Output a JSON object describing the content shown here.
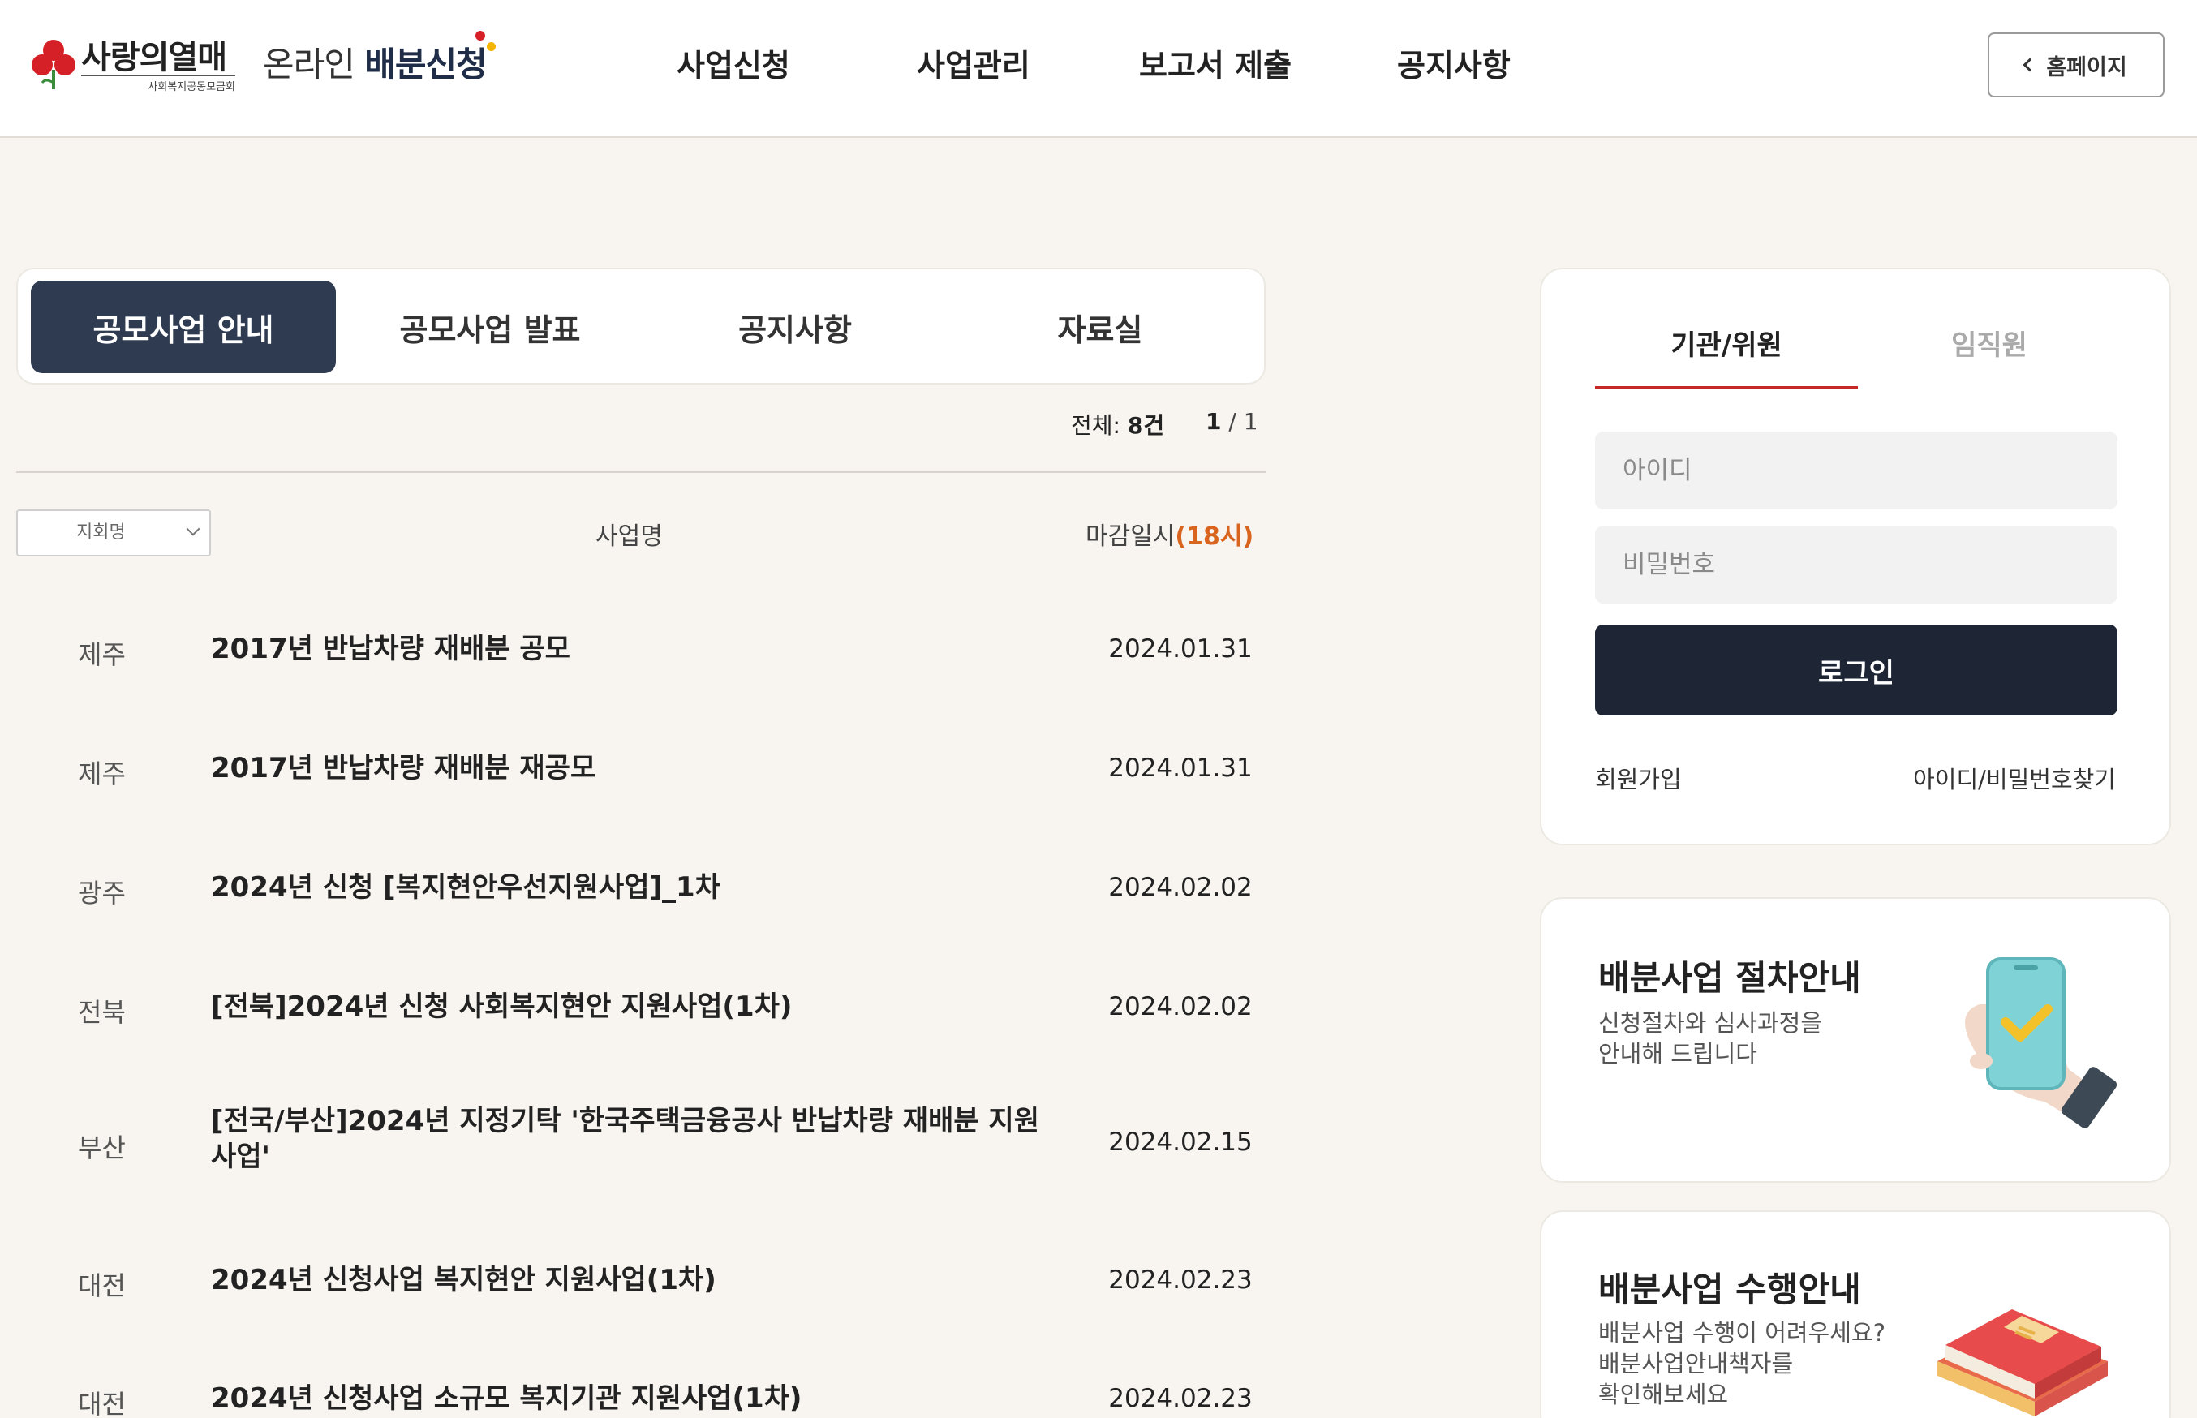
{
  "header": {
    "logo_brand": "사랑의열매",
    "logo_sub": "사회복지공동모금회",
    "service_prefix": "온라인 ",
    "service_bold": "배분신청",
    "nav": [
      "사업신청",
      "사업관리",
      "보고서 제출",
      "공지사항"
    ],
    "home_button": "홈페이지"
  },
  "tabs": [
    "공모사업 안내",
    "공모사업 발표",
    "공지사항",
    "자료실"
  ],
  "summary": {
    "total_label": "전체: ",
    "total_value": "8건",
    "page_current": "1",
    "page_sep": " / ",
    "page_total": "1"
  },
  "list_head": {
    "region_placeholder": "지회명",
    "title": "사업명",
    "deadline_label": "마감일시",
    "deadline_time": "(18시)"
  },
  "rows": [
    {
      "region": "제주",
      "title": "2017년 반납차량 재배분 공모",
      "date": "2024.01.31"
    },
    {
      "region": "제주",
      "title": "2017년 반납차량 재배분 재공모",
      "date": "2024.01.31"
    },
    {
      "region": "광주",
      "title": "2024년 신청 [복지현안우선지원사업]_1차",
      "date": "2024.02.02"
    },
    {
      "region": "전북",
      "title": "[전북]2024년 신청 사회복지현안 지원사업(1차)",
      "date": "2024.02.02"
    },
    {
      "region": "부산",
      "title": "[전국/부산]2024년 지정기탁 '한국주택금융공사 반납차량 재배분 지원사업'",
      "date": "2024.02.15"
    },
    {
      "region": "대전",
      "title": "2024년 신청사업 복지현안 지원사업(1차)",
      "date": "2024.02.23"
    },
    {
      "region": "대전",
      "title": "2024년 신청사업 소규모 복지기관 지원사업(1차)",
      "date": "2024.02.23"
    }
  ],
  "login": {
    "tab_active": "기관/위원",
    "tab_inactive": "임직원",
    "id_placeholder": "아이디",
    "pw_placeholder": "비밀번호",
    "login_button": "로그인",
    "join_link": "회원가입",
    "find_link": "아이디/비밀번호찾기"
  },
  "guides": [
    {
      "title": "배분사업 절차안내",
      "desc1": "신청절차와 심사과정을",
      "desc2": "안내해 드립니다",
      "icon": "phone-check-icon"
    },
    {
      "title": "배분사업 수행안내",
      "desc1": "배분사업 수행이 어려우세요?",
      "desc2": "배분사업안내책자를",
      "desc3": "확인해보세요",
      "icon": "books-icon"
    }
  ],
  "colors": {
    "accent_navy": "#2f3b50",
    "login_button": "#1e2636",
    "tab_underline": "#c62828",
    "deadline_highlight": "#d9641e",
    "brand_red": "#d62027",
    "page_bg": "#f8f5f0"
  }
}
